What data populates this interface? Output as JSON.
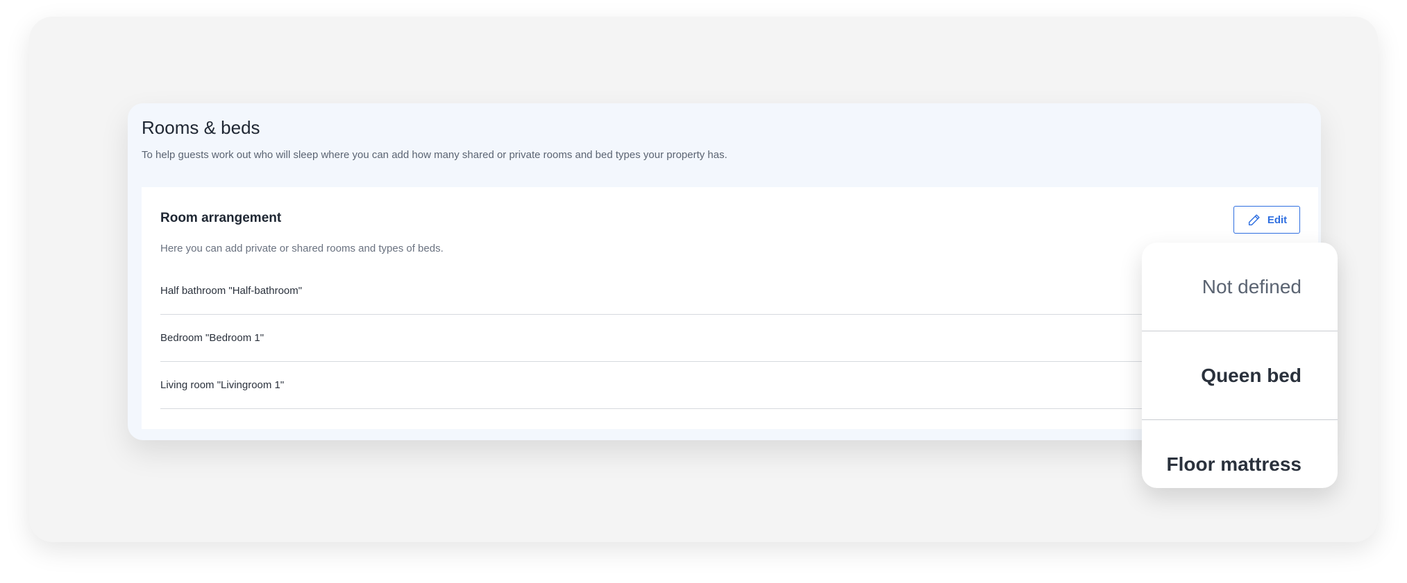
{
  "section": {
    "title": "Rooms & beds",
    "description": "To help guests work out who will sleep where you can add how many shared or private rooms and bed types your property has."
  },
  "arrangement": {
    "title": "Room arrangement",
    "description": "Here you can add private or shared rooms and types of beds.",
    "edit_label": "Edit",
    "edit_icon": "pencil-icon",
    "rooms": [
      {
        "label": "Half bathroom \"Half-bathroom\""
      },
      {
        "label": "Bedroom \"Bedroom 1\""
      },
      {
        "label": "Living room \"Livingroom 1\""
      }
    ]
  },
  "bed_dropdown": {
    "options": [
      {
        "label": "Not defined"
      },
      {
        "label": "Queen bed"
      },
      {
        "label": "Floor mattress"
      }
    ]
  },
  "colors": {
    "accent": "#2f6fe0",
    "text_primary": "#1f2733",
    "card_background": "#f3f7fd",
    "stage_background": "#f4f4f4"
  }
}
